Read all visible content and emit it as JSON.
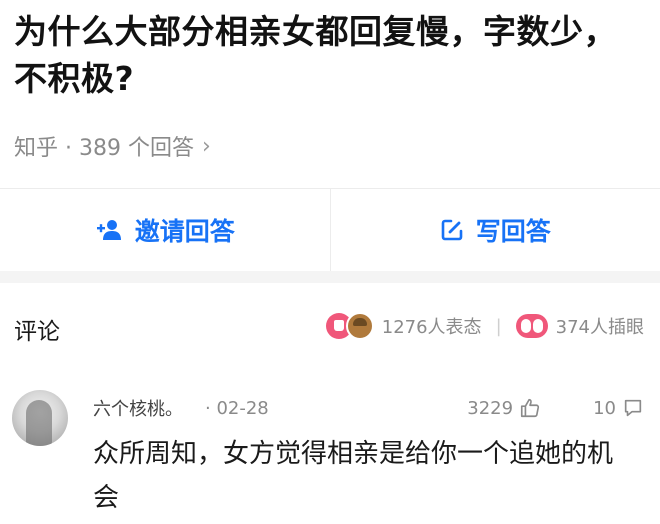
{
  "question": {
    "title": "为什么大部分相亲女都回复慢，字数少，不积极?"
  },
  "meta": {
    "text": "知乎 · 389 个回答",
    "chevron": "›"
  },
  "actions": {
    "invite_label": "邀请回答",
    "write_label": "写回答"
  },
  "comments": {
    "title": "评论",
    "reactions_count_text": "1276人表态",
    "separator": "|",
    "eyes_count_text": "374人插眼"
  },
  "comment": {
    "author": "六个核桃。",
    "date": "· 02-28",
    "likes": "3229",
    "replies": "10",
    "text": "众所周知，女方觉得相亲是给你一个追她的机会"
  },
  "colors": {
    "accent": "#1772f6",
    "muted": "#8a8a8a",
    "reaction_pink": "#f0577a"
  },
  "icons": {
    "invite": "add-user-icon",
    "write": "edit-icon",
    "like": "thumbs-up-icon",
    "reply": "comment-icon"
  }
}
